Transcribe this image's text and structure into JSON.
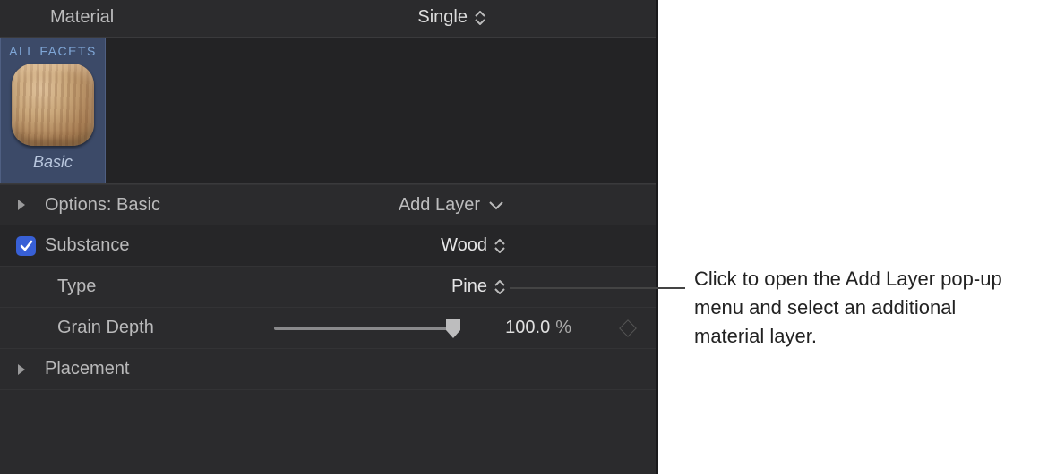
{
  "header": {
    "label": "Material",
    "value": "Single"
  },
  "facet": {
    "title": "ALL FACETS",
    "name": "Basic"
  },
  "rows": {
    "options_label": "Options: Basic",
    "add_layer_label": "Add Layer",
    "substance_label": "Substance",
    "substance_value": "Wood",
    "type_label": "Type",
    "type_value": "Pine",
    "grain_depth_label": "Grain Depth",
    "grain_depth_value": "100.0",
    "grain_depth_unit": "%",
    "grain_depth_percent": 100,
    "placement_label": "Placement"
  },
  "annotation": "Click to open the Add Layer pop-up menu and select an additional material layer."
}
